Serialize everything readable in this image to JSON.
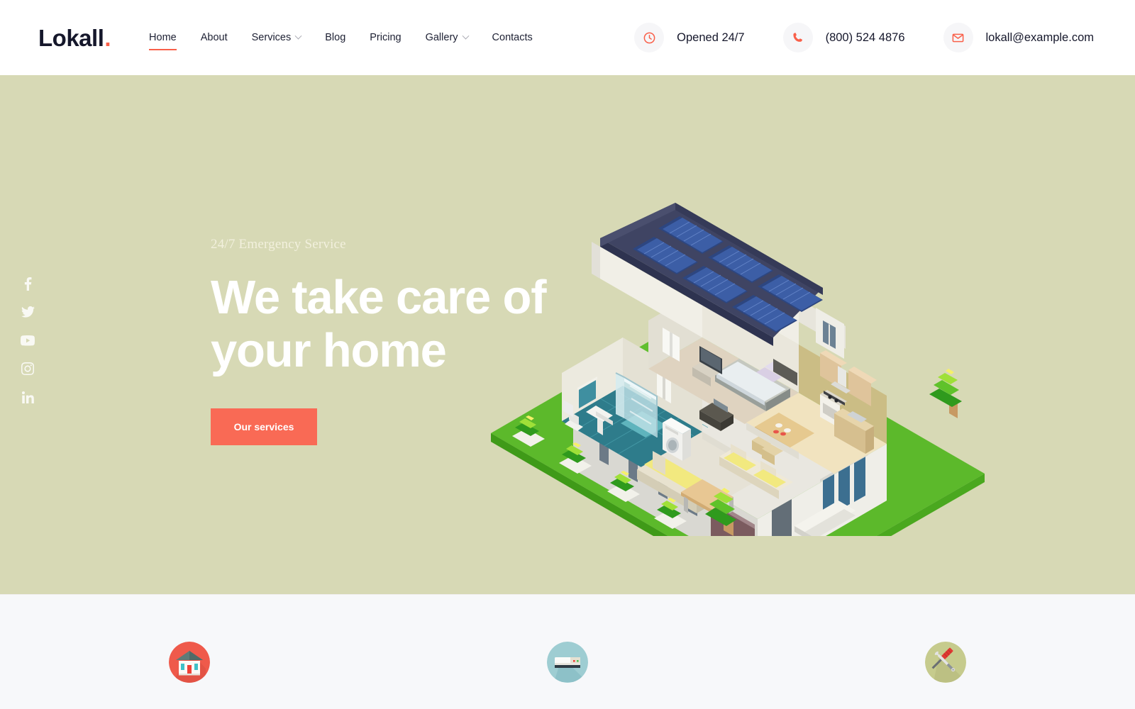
{
  "brand": {
    "name": "Lokall",
    "dot": ".",
    "accent_color": "#f9604a",
    "text_color": "#15172b"
  },
  "nav": {
    "items": [
      {
        "label": "Home",
        "active": true,
        "caret": false
      },
      {
        "label": "About",
        "active": false,
        "caret": false
      },
      {
        "label": "Services",
        "active": false,
        "caret": true
      },
      {
        "label": "Blog",
        "active": false,
        "caret": false
      },
      {
        "label": "Pricing",
        "active": false,
        "caret": false
      },
      {
        "label": "Gallery",
        "active": false,
        "caret": true
      },
      {
        "label": "Contacts",
        "active": false,
        "caret": false
      }
    ]
  },
  "header_contacts": [
    {
      "icon": "clock-icon",
      "text": "Opened 24/7"
    },
    {
      "icon": "phone-icon",
      "text": "(800) 524 4876"
    },
    {
      "icon": "mail-icon",
      "text": "lokall@example.com"
    }
  ],
  "social": [
    {
      "icon": "facebook-icon",
      "label": "Facebook"
    },
    {
      "icon": "twitter-icon",
      "label": "Twitter"
    },
    {
      "icon": "youtube-icon",
      "label": "YouTube"
    },
    {
      "icon": "instagram-icon",
      "label": "Instagram"
    },
    {
      "icon": "linkedin-icon",
      "label": "LinkedIn"
    }
  ],
  "hero": {
    "kicker": "24/7 Emergency Service",
    "title_line1": "We take care of",
    "title_line2": "your home",
    "cta_label": "Our services",
    "background_color": "#d7d9b5",
    "cta_color": "#f96a55",
    "illustration": "isometric-cutaway-house-with-solar-panels"
  },
  "services_strip": {
    "background_color": "#f7f8fa",
    "items": [
      {
        "icon": "house-icon",
        "circle_color": "#ef5a4b"
      },
      {
        "icon": "air-conditioner-icon",
        "circle_color": "#9ecdd2"
      },
      {
        "icon": "tools-icon",
        "circle_color": "#c6cb8d"
      }
    ]
  }
}
